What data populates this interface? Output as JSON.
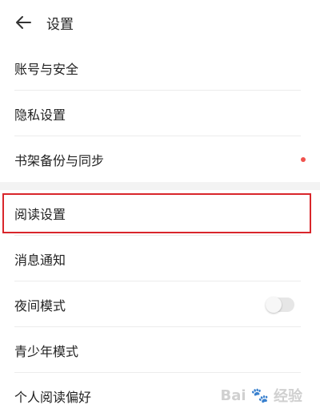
{
  "header": {
    "title": "设置",
    "back_icon": "arrow-left-icon"
  },
  "menu": {
    "group1": [
      {
        "label": "账号与安全"
      },
      {
        "label": "隐私设置"
      },
      {
        "label": "书架备份与同步",
        "badge": "dot"
      }
    ],
    "group2": [
      {
        "label": "阅读设置",
        "highlighted": true
      },
      {
        "label": "消息通知"
      },
      {
        "label": "夜间模式",
        "toggle": false
      },
      {
        "label": "青少年模式"
      },
      {
        "label": "个人阅读偏好"
      }
    ]
  },
  "watermark": {
    "text": "Bai",
    "text2": "经验"
  },
  "colors": {
    "badge_dot": "#f0524d",
    "highlight_border": "#d9262b",
    "section_gap": "#f3f3f3",
    "separator": "#ececec"
  }
}
